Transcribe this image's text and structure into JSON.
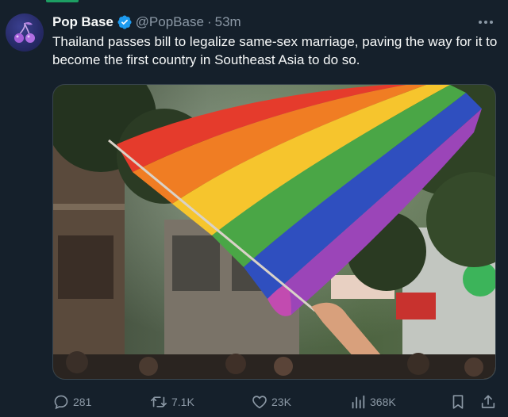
{
  "tweet": {
    "display_name": "Pop Base",
    "handle": "@PopBase",
    "separator": "·",
    "time": "53m",
    "text": "Thailand passes bill to legalize same-sex marriage, paving the way for it to become the first country in Southeast Asia to do so."
  },
  "actions": {
    "replies": "281",
    "retweets": "7.1K",
    "likes": "23K",
    "views": "368K"
  },
  "icons": {
    "verified": "verified-badge-icon",
    "more": "more-dots-icon",
    "reply": "reply-icon",
    "retweet": "retweet-icon",
    "like": "heart-icon",
    "views": "analytics-icon",
    "bookmark": "bookmark-icon",
    "share": "share-icon"
  },
  "colors": {
    "background": "#15202b",
    "text_primary": "#f7f9f9",
    "text_secondary": "#8b98a5",
    "verified_blue": "#1d9bf0",
    "accent_green": "#1d9e63"
  }
}
